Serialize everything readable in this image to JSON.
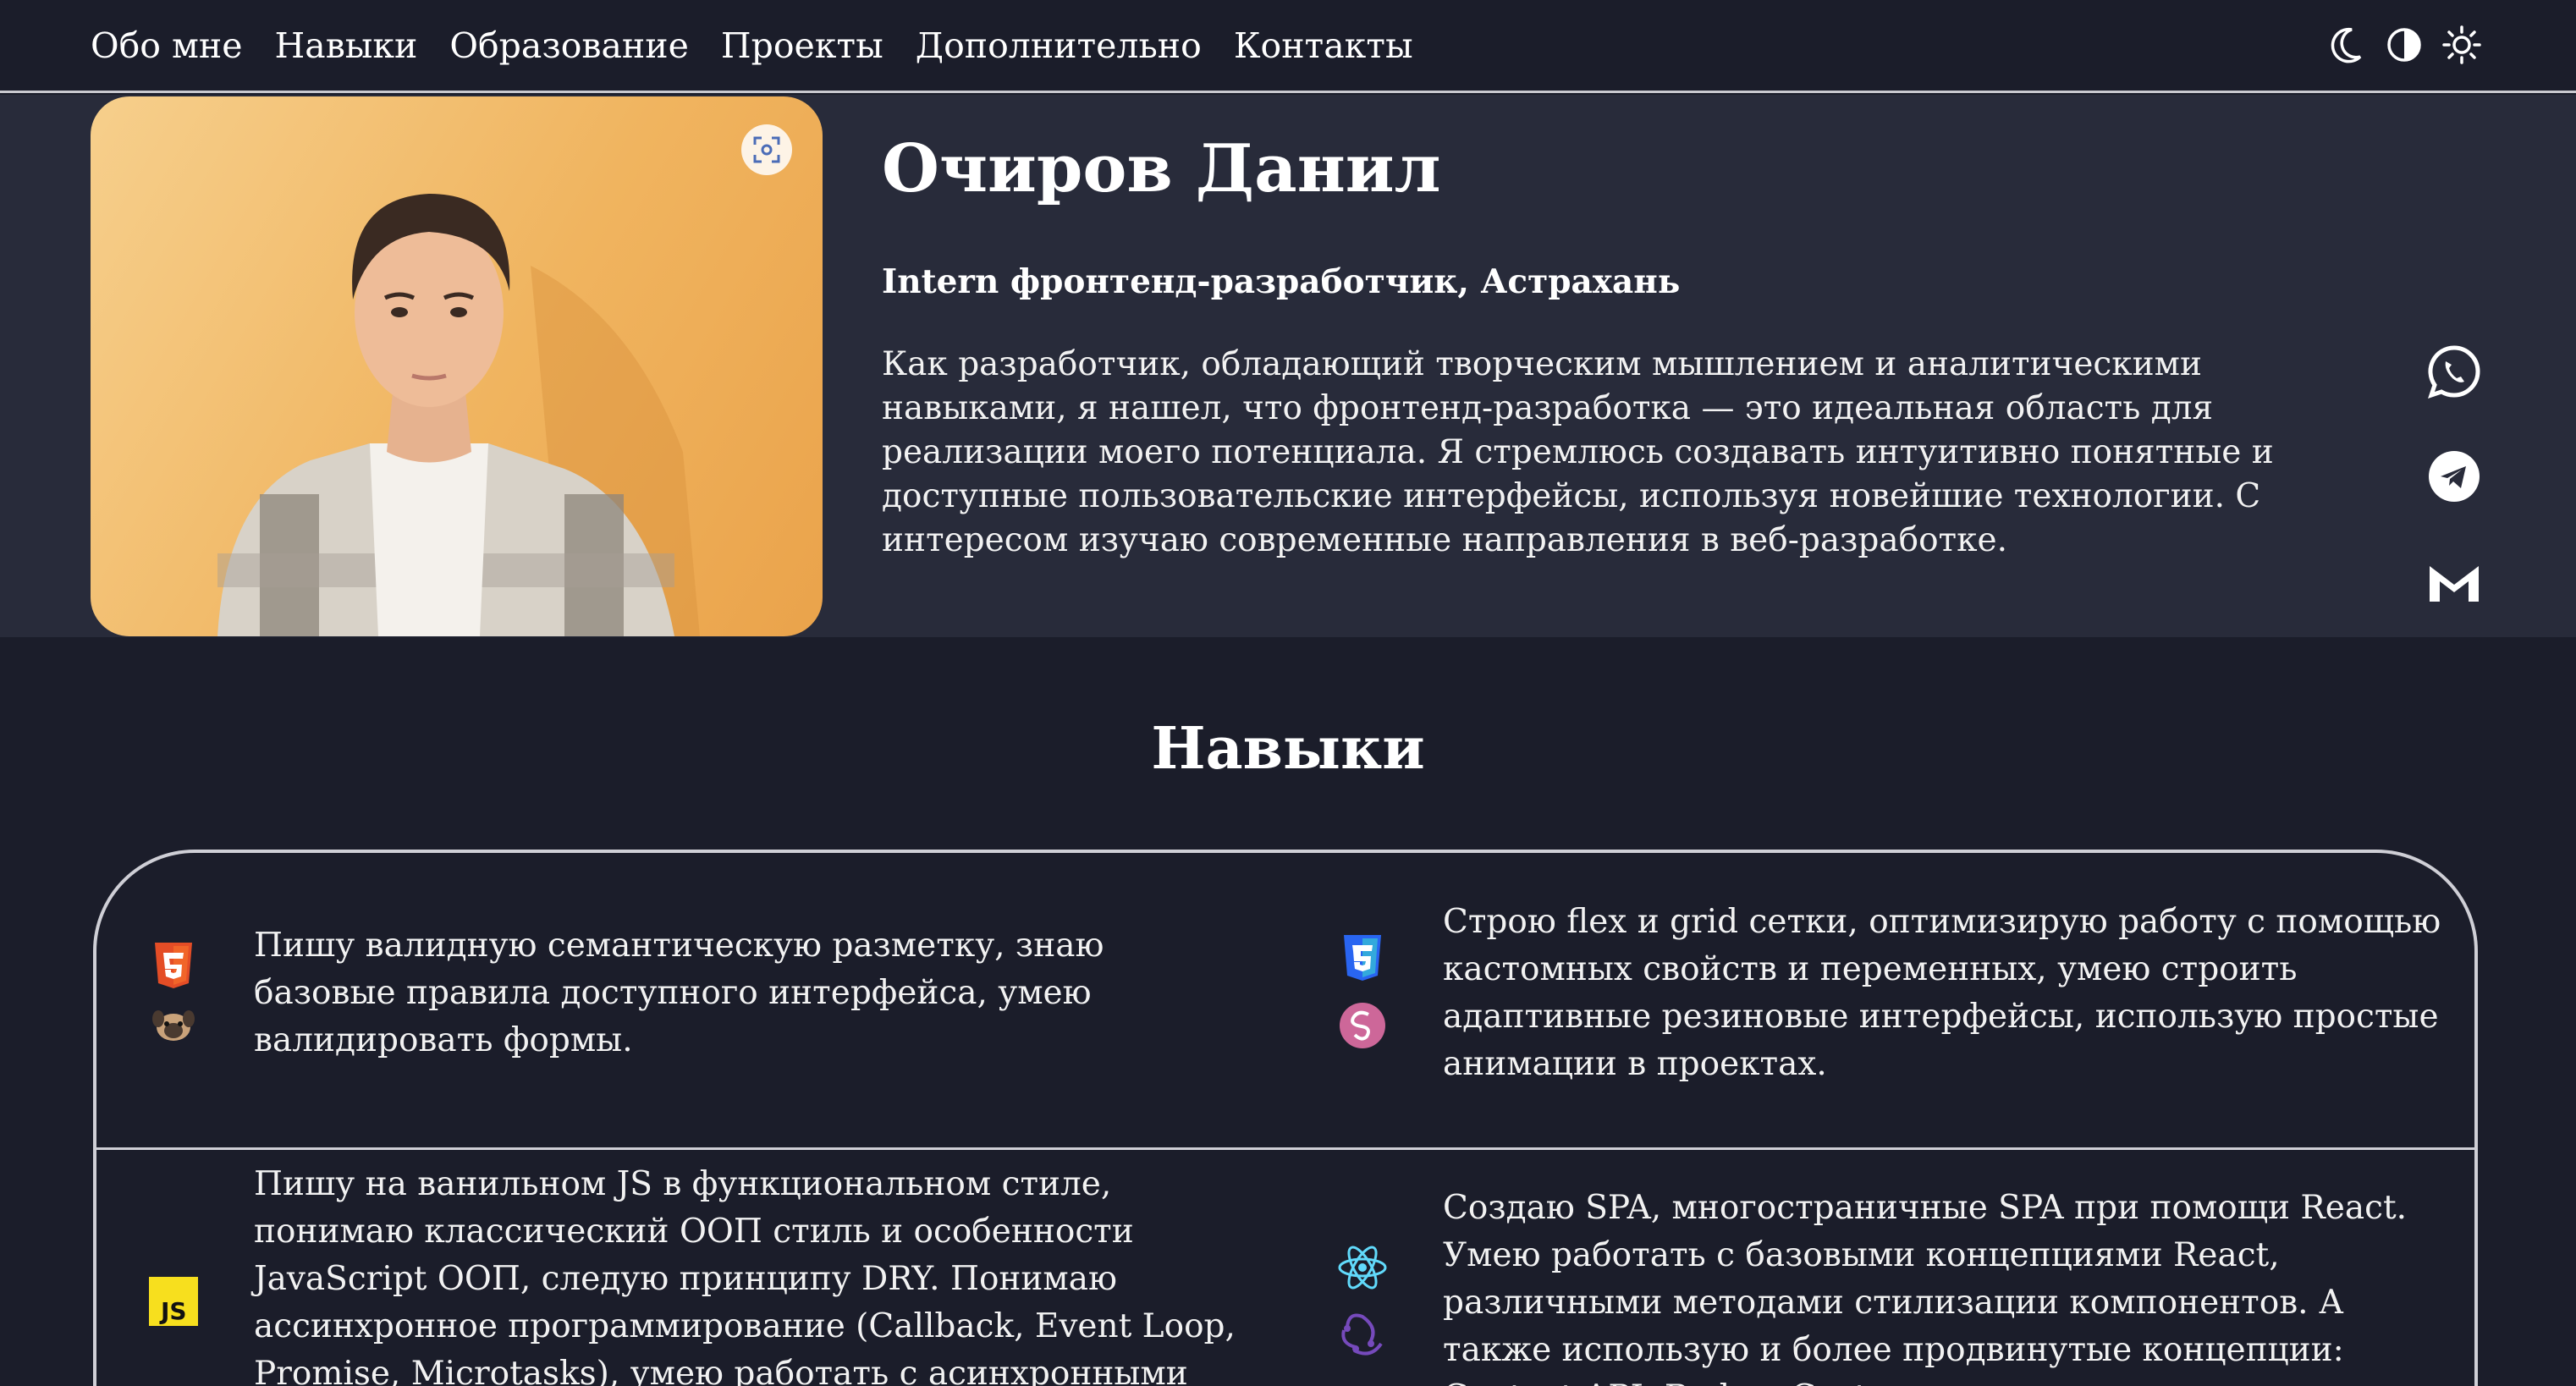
{
  "nav": {
    "links": [
      "Обо мне",
      "Навыки",
      "Образование",
      "Проекты",
      "Дополнительно",
      "Контакты"
    ],
    "theme_icons": [
      "moon-icon",
      "half-circle-icon",
      "sun-icon"
    ]
  },
  "hero": {
    "name": "Очиров Данил",
    "role": "Intern фронтенд-разработчик, Астрахань",
    "description": "Как разработчик, обладающий творческим мышлением и аналитическими навыками, я нашел, что фронтенд-разработка — это идеальная область для реализации моего потенциала. Я стремлюсь создавать интуитивно понятные и доступные пользовательские интерфейсы, используя новейшие технологии. С интересом изучаю современные направления в веб-разработке.",
    "socials": [
      "whatsapp-icon",
      "telegram-icon",
      "gmail-icon"
    ]
  },
  "skills": {
    "title": "Навыки",
    "items": [
      {
        "icons": [
          "html5-icon",
          "pug-icon"
        ],
        "text": "Пишу валидную семантическую разметку, знаю базовые правила доступного интерфейса, умею валидировать формы."
      },
      {
        "icons": [
          "css3-icon",
          "sass-icon"
        ],
        "text": "Строю flex и grid сетки, оптимизирую работу с помощью кастомных свойств и переменных, умею строить адаптивные резиновые интерфейсы, использую простые анимации в проектах."
      },
      {
        "icons": [
          "javascript-icon"
        ],
        "text": "Пишу на ванильном JS в функциональном стиле, понимаю классический ООП стиль и особенности JavaScript ООП, следую принципу DRY. Понимаю ассинхронное программирование (Callback, Event Loop, Promise, Microtasks), умею работать с асинхронными операциями"
      },
      {
        "icons": [
          "react-icon",
          "redux-icon"
        ],
        "text": "Создаю SPA, многостраничные SPA при помощи React. Умею работать с базовыми концепциями React, различными методами стилизации компонентов. А также использую и более продвинутые концепции: Context API, Redux, Custom"
      }
    ]
  },
  "colors": {
    "background": "#1b1d2a",
    "hero_background": "#282b3a",
    "border": "#cfcfd6",
    "html5": "#e44d26",
    "css3": "#2965f1",
    "sass": "#cd6799",
    "javascript": "#f7df1e",
    "react": "#61dafb",
    "redux": "#764abc"
  }
}
